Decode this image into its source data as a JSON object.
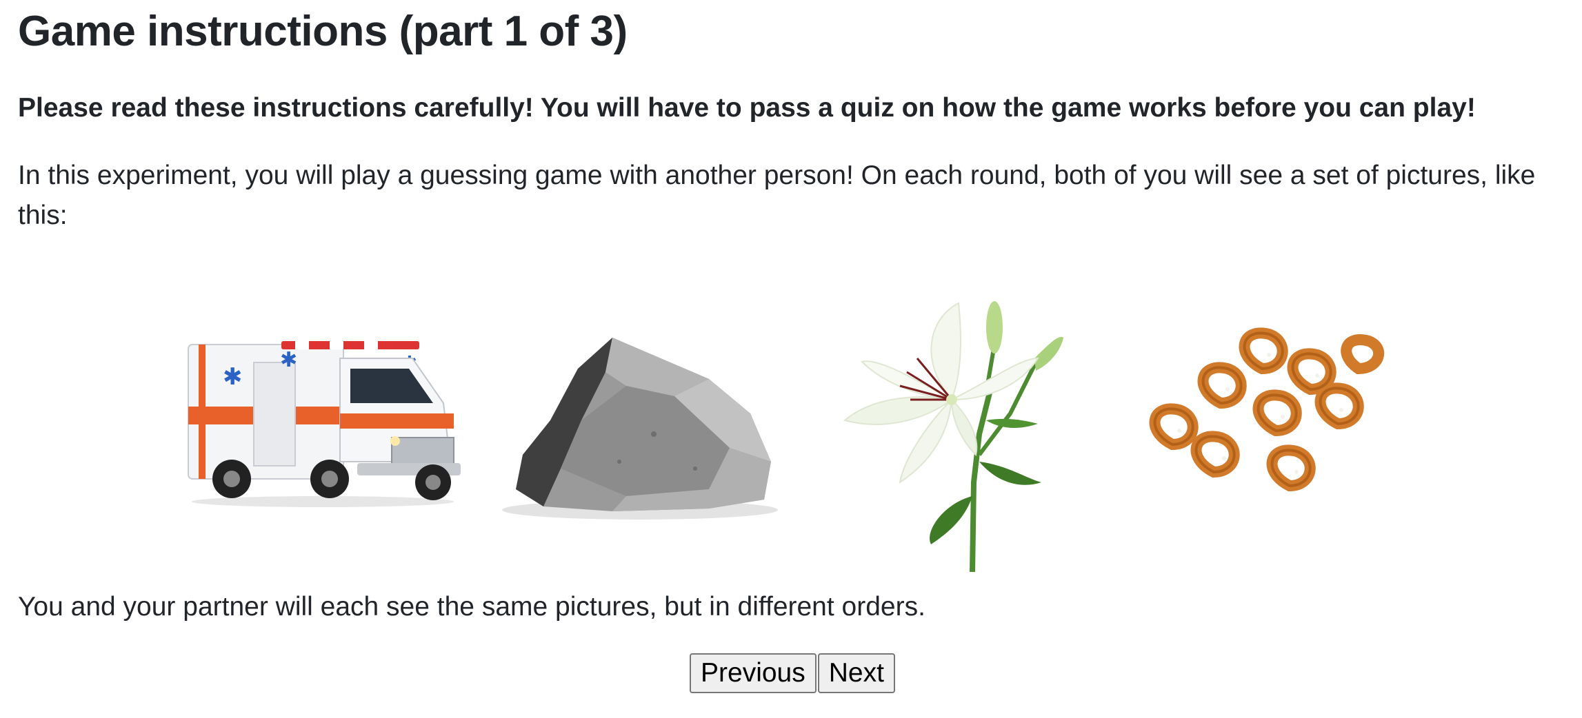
{
  "title": "Game instructions (part 1 of 3)",
  "warning": "Please read these instructions carefully! You will have to pass a quiz on how the game works before you can play!",
  "intro": "In this experiment, you will play a guessing game with another person! On each round, both of you will see a set of pictures, like this:",
  "pictures": [
    {
      "icon": "ambulance-picture"
    },
    {
      "icon": "rock-picture"
    },
    {
      "icon": "lily-flower-picture"
    },
    {
      "icon": "pretzels-picture"
    }
  ],
  "note": "You and your partner will each see the same pictures, but in different orders.",
  "nav": {
    "previous_label": "Previous",
    "next_label": "Next"
  }
}
